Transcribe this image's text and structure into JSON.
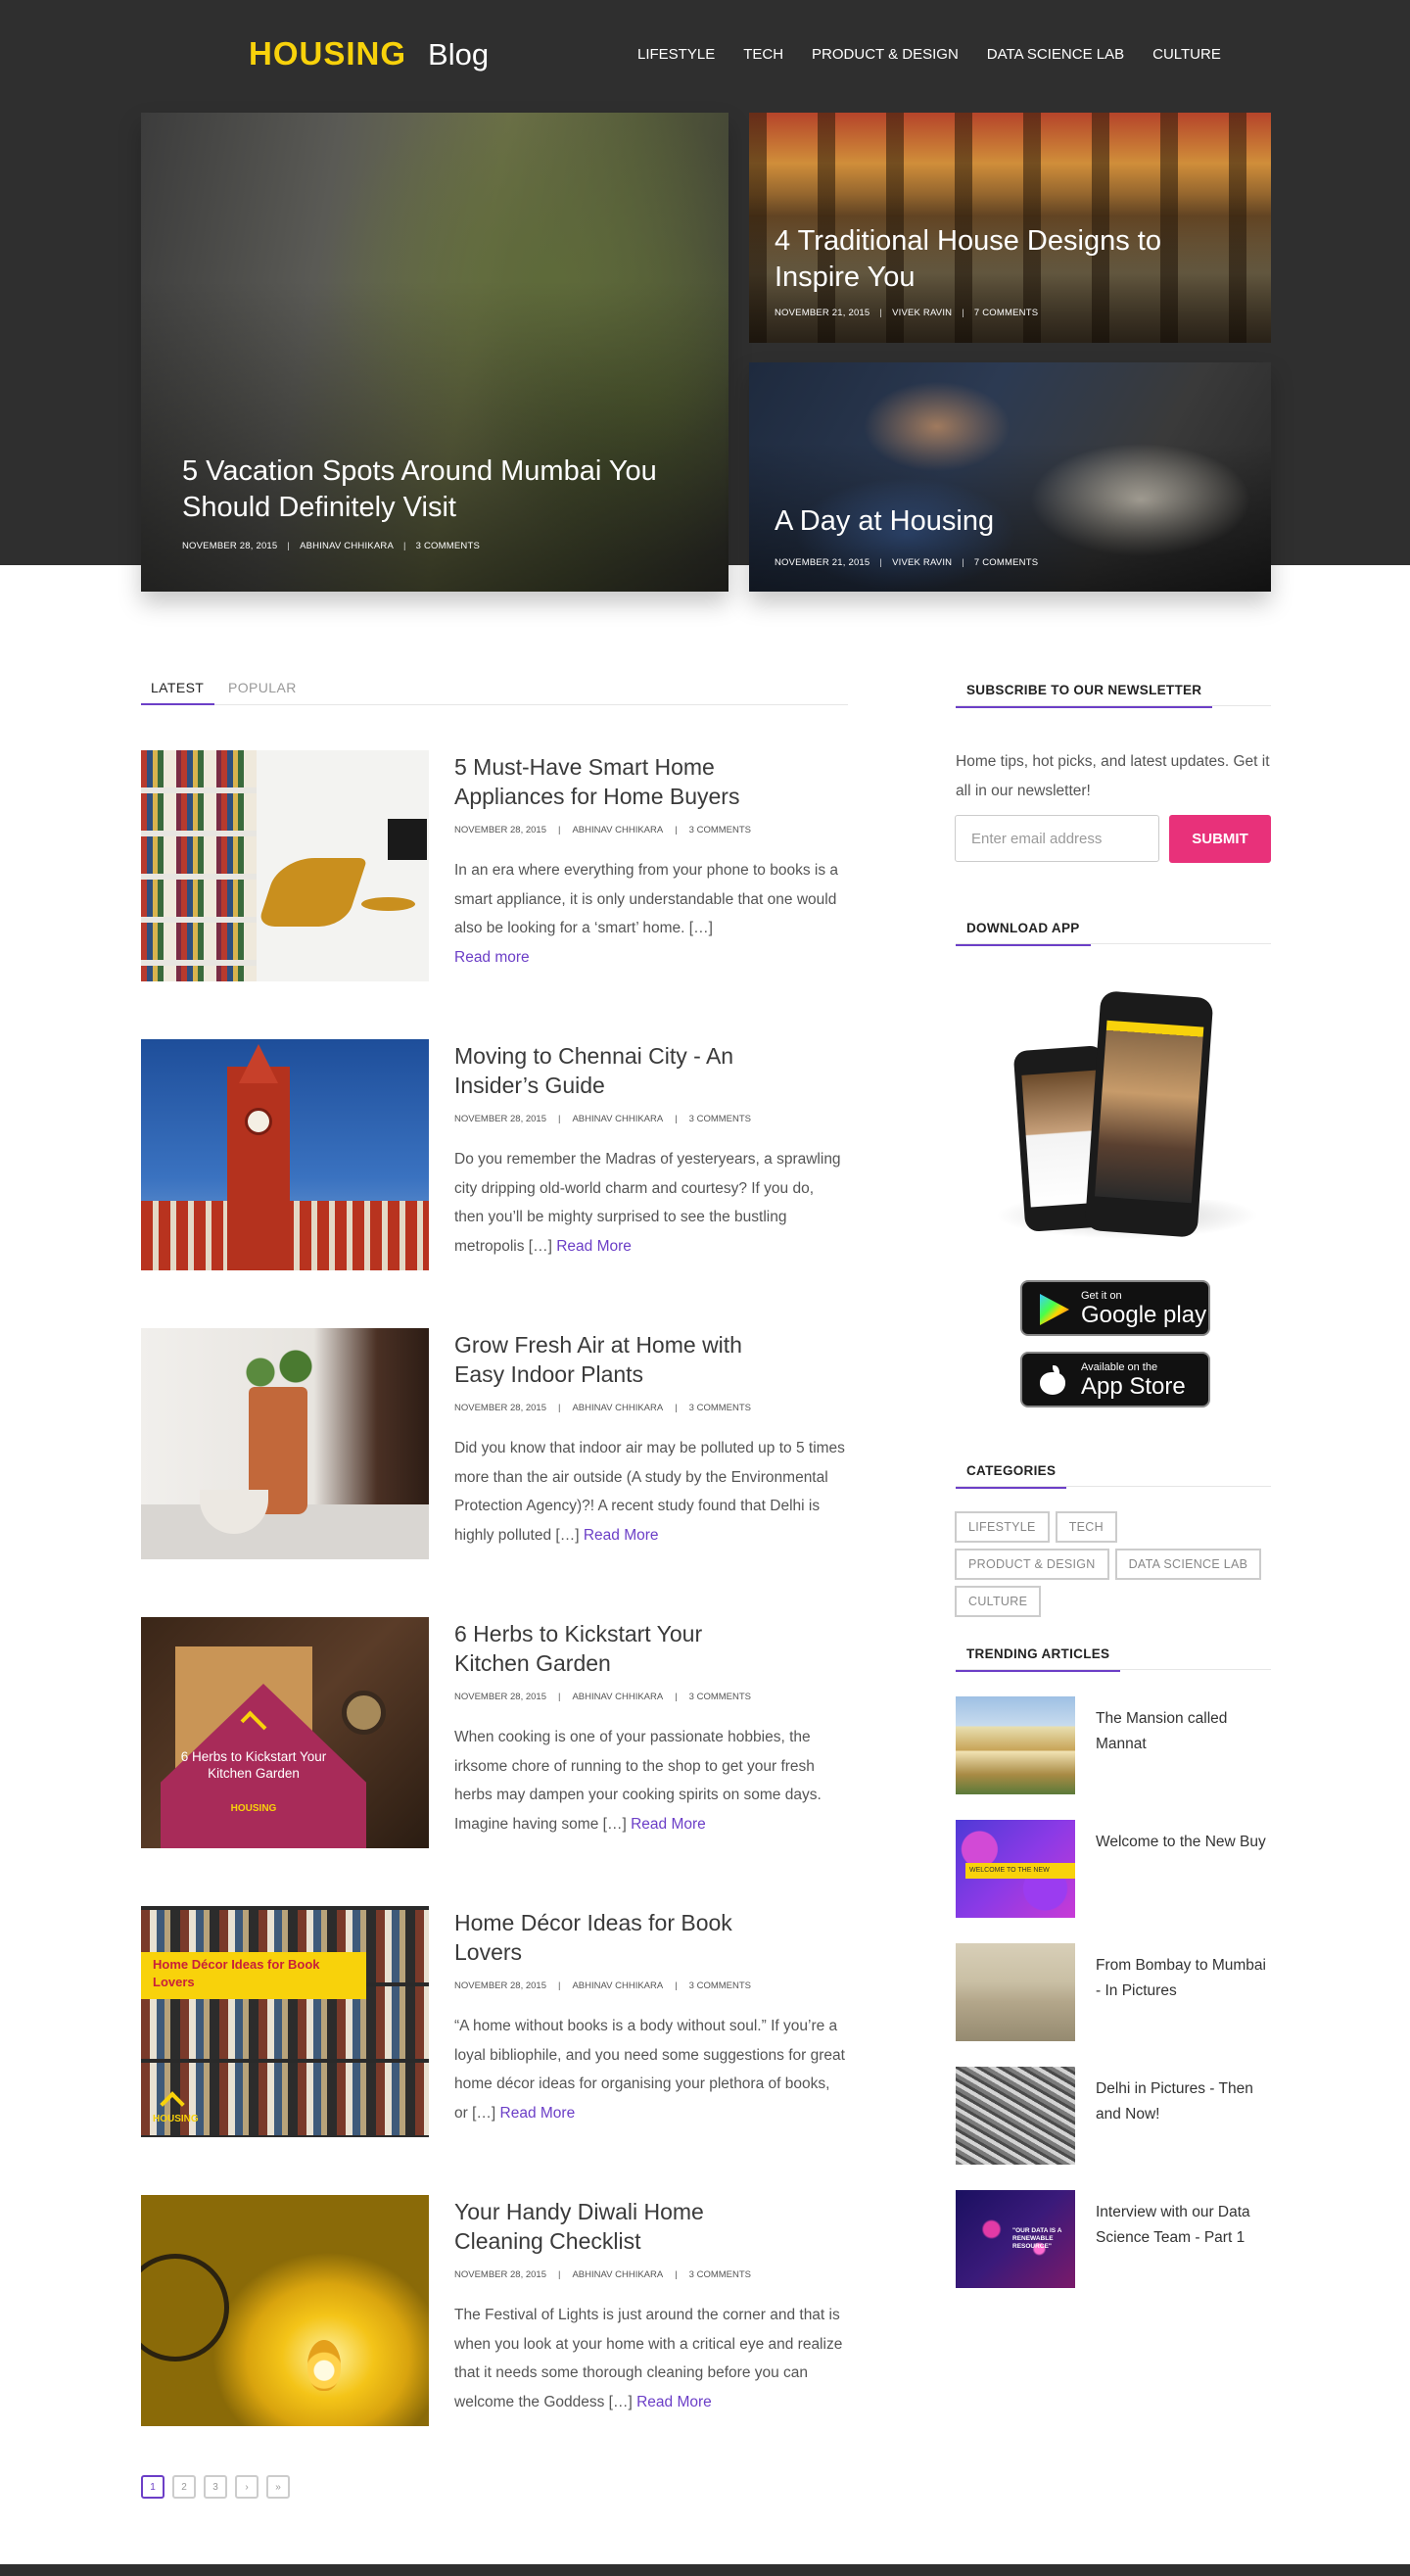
{
  "header": {
    "logo_main": "HOUSING",
    "logo_sub": "Blog",
    "nav": [
      "LIFESTYLE",
      "TECH",
      "PRODUCT & DESIGN",
      "DATA SCIENCE LAB",
      "CULTURE"
    ]
  },
  "hero": [
    {
      "title": "5 Vacation Spots Around Mumbai You Should Definitely Visit",
      "date": "NOVEMBER 28, 2015",
      "author": "ABHINAV CHHIKARA",
      "comments": "3 COMMENTS"
    },
    {
      "title": "4 Traditional House Designs to Inspire You",
      "date": "NOVEMBER 21, 2015",
      "author": "VIVEK RAVIN",
      "comments": "7 COMMENTS"
    },
    {
      "title": "A Day at Housing",
      "date": "NOVEMBER 21, 2015",
      "author": "VIVEK RAVIN",
      "comments": "7 COMMENTS"
    }
  ],
  "tabs": {
    "latest": "LATEST",
    "popular": "POPULAR"
  },
  "posts": [
    {
      "title": "5 Must-Have Smart Home Appliances for Home Buyers",
      "date": "NOVEMBER 28, 2015",
      "author": "ABHINAV CHHIKARA",
      "comments": "3 COMMENTS",
      "excerpt": "In an era where everything from your phone to books is a smart appliance, it is only understandable that one would also be looking for a ‘smart’ home. […]",
      "read_more": "Read more"
    },
    {
      "title": "Moving to Chennai City - An Insider’s Guide",
      "date": "NOVEMBER 28, 2015",
      "author": "ABHINAV CHHIKARA",
      "comments": "3 COMMENTS",
      "excerpt": "Do you remember the Madras of yesteryears, a sprawling city dripping old-world charm and courtesy? If you do, then you’ll be mighty surprised to see the bustling metropolis […]",
      "read_more": "Read More"
    },
    {
      "title": "Grow Fresh Air at Home with Easy Indoor Plants",
      "date": "NOVEMBER 28, 2015",
      "author": "ABHINAV CHHIKARA",
      "comments": "3 COMMENTS",
      "excerpt": "Did you know that indoor air may be polluted up to 5 times more than the air outside (A study by the Environmental Protection Agency)?! A recent study found that Delhi is highly polluted […]",
      "read_more": "Read More"
    },
    {
      "title": "6 Herbs to Kickstart Your Kitchen Garden",
      "date": "NOVEMBER 28, 2015",
      "author": "ABHINAV CHHIKARA",
      "comments": "3 COMMENTS",
      "excerpt": "When cooking is one of your passionate hobbies, the irksome chore of running to the shop to get your fresh herbs may dampen your cooking spirits on some days. Imagine having some […]",
      "read_more": "Read More",
      "image_text": "6 Herbs to Kickstart Your Kitchen Garden",
      "image_brand": "HOUSING"
    },
    {
      "title": "Home Décor Ideas for Book Lovers",
      "date": "NOVEMBER 28, 2015",
      "author": "ABHINAV CHHIKARA",
      "comments": "3 COMMENTS",
      "excerpt": "“A home without books is a body without soul.” If you’re a loyal bibliophile, and you need some suggestions for great home décor ideas for organising your plethora of books, or […]",
      "read_more": "Read More",
      "image_text": "Home Décor Ideas for Book Lovers",
      "image_brand": "HOUSING"
    },
    {
      "title": "Your Handy Diwali Home Cleaning Checklist",
      "date": "NOVEMBER 28, 2015",
      "author": "ABHINAV CHHIKARA",
      "comments": "3 COMMENTS",
      "excerpt": "The Festival of Lights is just around the corner and that is when you look at your home with a critical eye and realize that it needs some thorough cleaning before you can welcome the Goddess […]",
      "read_more": "Read More"
    }
  ],
  "pagination": [
    "1",
    "2",
    "3",
    "›",
    "»"
  ],
  "sidebar": {
    "newsletter": {
      "title": "SUBSCRIBE TO OUR NEWSLETTER",
      "text": "Home tips, hot picks, and latest updates. Get it all in our newsletter!",
      "placeholder": "Enter email address",
      "submit": "SUBMIT"
    },
    "download": {
      "title": "DOWNLOAD APP",
      "google_small": "Get it on",
      "google_big": "Google play",
      "apple_small": "Available on the",
      "apple_big": "App Store"
    },
    "categories": {
      "title": "CATEGORIES",
      "items": [
        "LIFESTYLE",
        "TECH",
        "PRODUCT & DESIGN",
        "DATA SCIENCE LAB",
        "CULTURE"
      ]
    },
    "trending": {
      "title": "TRENDING ARTICLES",
      "items": [
        {
          "title": "The Mansion called Mannat"
        },
        {
          "title": "Welcome to the New Buy",
          "image_text": "WELCOME TO THE NEW"
        },
        {
          "title": "From Bombay to Mumbai - In Pictures"
        },
        {
          "title": "Delhi in Pictures - Then and Now!"
        },
        {
          "title": "Interview with our Data Science Team - Part 1",
          "image_text": "\"OUR DATA IS A RENEWABLE RESOURCE\""
        }
      ]
    }
  }
}
